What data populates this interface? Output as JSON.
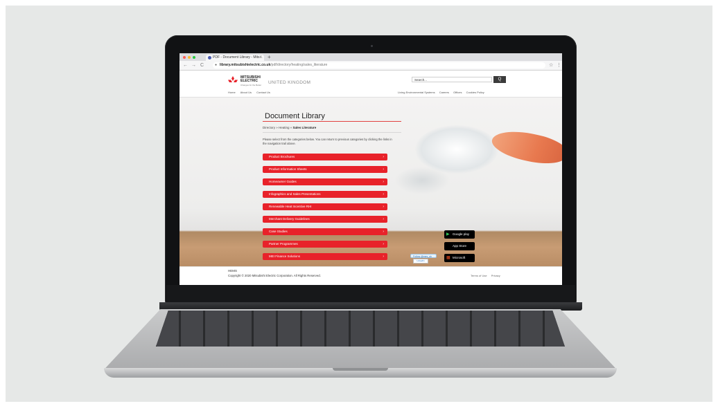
{
  "browser": {
    "tab_title": "PDF - Document Library - Mits...",
    "tab_close": "×",
    "new_tab": "+",
    "url_host": "library.mitsubishielectric.co.uk",
    "url_path": "/pdf/directory/heating/sales_literature",
    "back": "←",
    "forward": "→",
    "reload": "C",
    "star": "☆",
    "menu": "⋮"
  },
  "header": {
    "logo_text_1": "MITSUBISHI",
    "logo_text_2": "ELECTRIC",
    "logo_tagline": "Changes for the Better",
    "region": "UNITED KINGDOM",
    "search_placeholder": "Search...",
    "search_button": "Q",
    "nav_left": [
      "Home",
      "About Us",
      "Contact Us"
    ],
    "nav_right": [
      "Living Environmental Systems",
      "Careers",
      "Offices",
      "Cookies Policy"
    ]
  },
  "main": {
    "title": "Document Library",
    "breadcrumb_prefix": "Directory » Heating » ",
    "breadcrumb_current": "Sales Literature",
    "intro": "Please select from the categories below. You can return to previous categories by clicking the links in the navigation trail above.",
    "categories": [
      "Product Brochures",
      "Product Information Sheets",
      "Homeowner Guides",
      "Infographics and Sales Presentations",
      "Renewable Heat Incentive RHI",
      "Merchant Delivery Guidelines",
      "Case Studies",
      "Partner Programmes",
      "MEI Finance Solutions"
    ],
    "arrow": "›"
  },
  "badges": {
    "google": "Google play",
    "apple": "App Store",
    "microsoft": "Microsoft",
    "google_icon": "▶",
    "apple_icon": "",
    "microsoft_icon": "▦",
    "follow": "Follow @mes_uk",
    "linkedin": "LinkedIn"
  },
  "footer": {
    "label": "HEMS",
    "copyright": "Copyright © 2020 Mitsubishi Electric Corporation. All Rights Reserved.",
    "links": [
      "Terms of Use",
      "Privacy"
    ]
  },
  "colors": {
    "brand_red": "#e8222a",
    "orange_accent": "#e8794f"
  }
}
